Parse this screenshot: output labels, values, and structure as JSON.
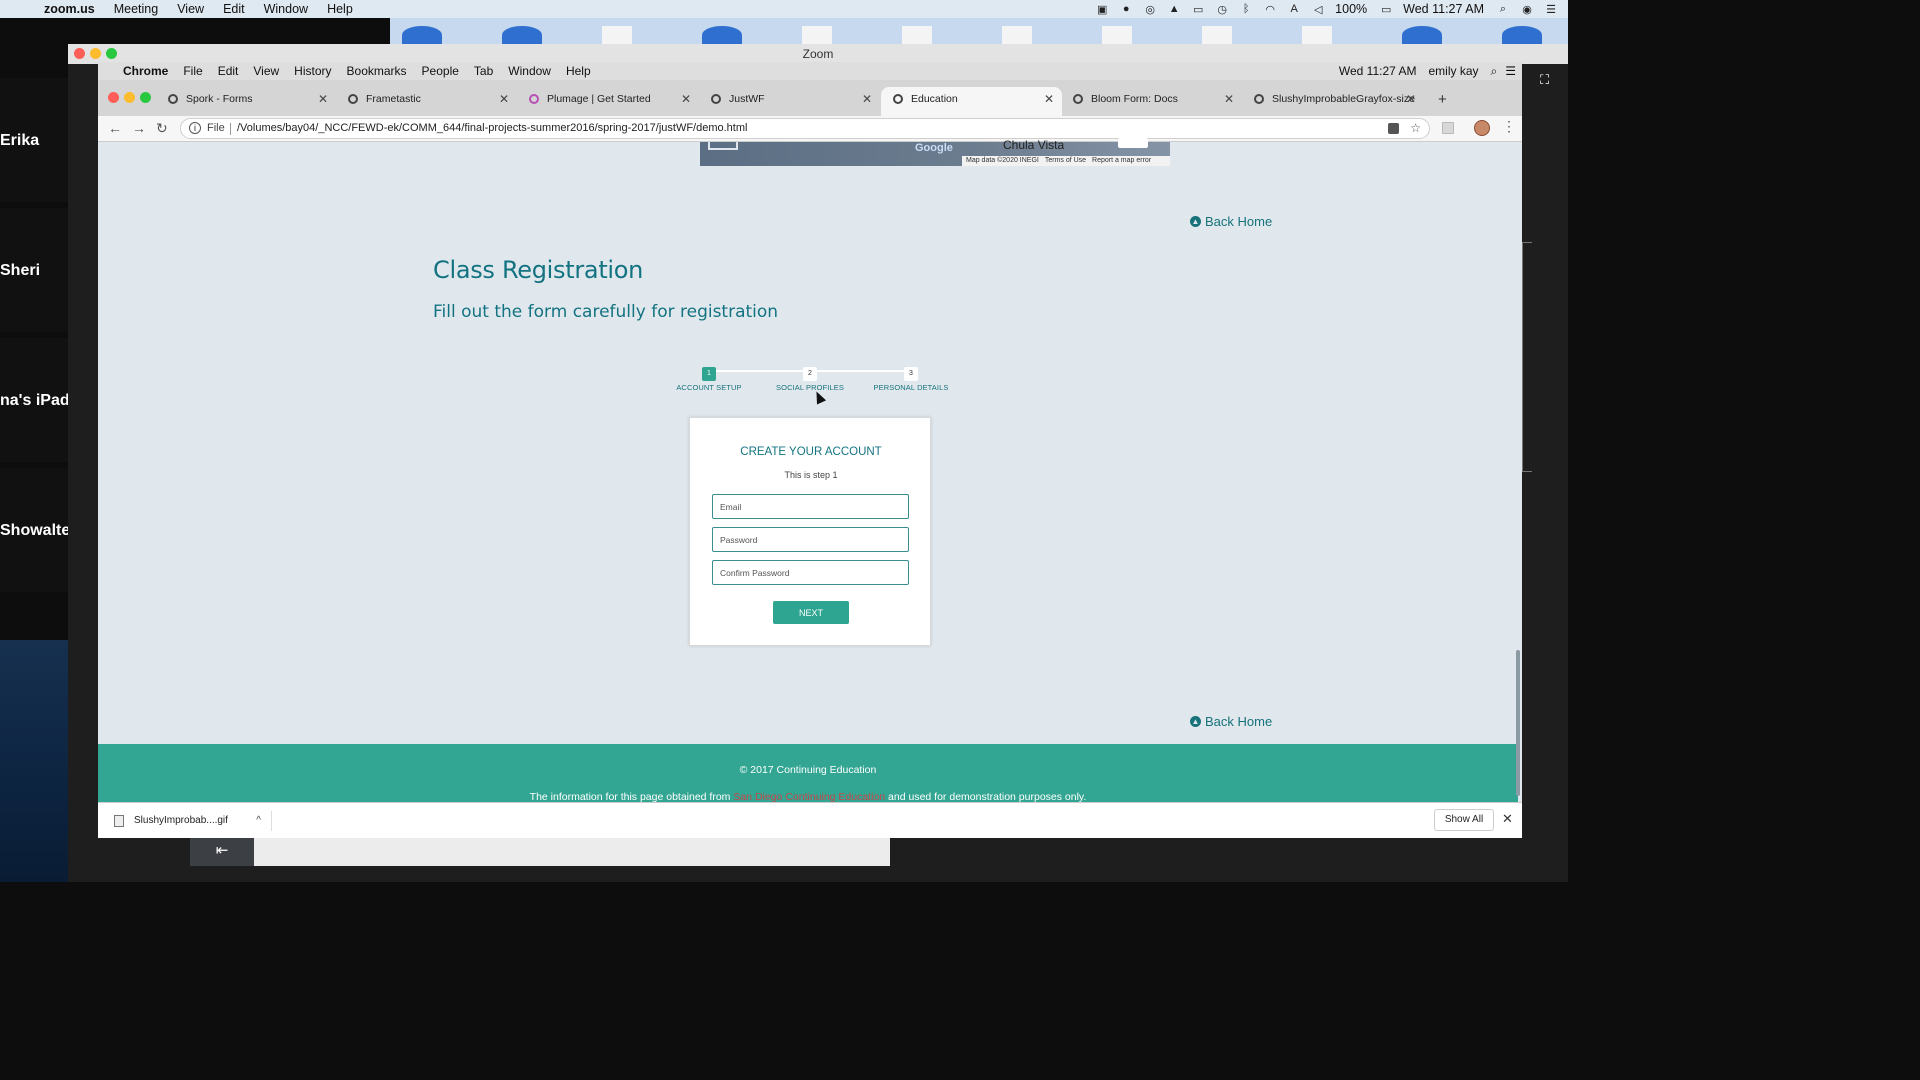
{
  "mac_menubar": {
    "app": "zoom.us",
    "items": [
      "Meeting",
      "View",
      "Edit",
      "Window",
      "Help"
    ],
    "battery": "100%",
    "clock": "Wed 11:27 AM"
  },
  "zoom": {
    "window_title": "Zoom",
    "participants": [
      "Erika",
      "Sheri",
      "na's iPad",
      "Showalte"
    ]
  },
  "chrome": {
    "app_menu": {
      "app": "Chrome",
      "items": [
        "File",
        "Edit",
        "View",
        "History",
        "Bookmarks",
        "People",
        "Tab",
        "Window",
        "Help"
      ],
      "clock": "Wed 11:27 AM",
      "user": "emily kay"
    },
    "tabs": [
      {
        "label": "Spork - Forms"
      },
      {
        "label": "Frametastic"
      },
      {
        "label": "Plumage | Get Started"
      },
      {
        "label": "JustWF"
      },
      {
        "label": "Education"
      },
      {
        "label": "Bloom Form: Docs"
      },
      {
        "label": "SlushyImprobableGrayfox-size"
      }
    ],
    "address": {
      "scheme_label": "File",
      "url": "/Volumes/bay04/_NCC/FEWD-ek/COMM_644/final-projects-summer2016/spring-2017/justWF/demo.html"
    }
  },
  "map": {
    "city": "Chula Vista",
    "google": "Google",
    "attribution": [
      "Map data ©2020 INEGI",
      "Terms of Use",
      "Report a map error"
    ]
  },
  "page": {
    "back_home": "Back Home",
    "title": "Class Registration",
    "subtitle": "Fill out the form carefully for registration",
    "steps": [
      {
        "num": "1",
        "label": "ACCOUNT SETUP"
      },
      {
        "num": "2",
        "label": "SOCIAL PROFILES"
      },
      {
        "num": "3",
        "label": "PERSONAL DETAILS"
      }
    ],
    "form": {
      "title": "CREATE YOUR ACCOUNT",
      "step_text": "This is step 1",
      "email_placeholder": "Email",
      "password_placeholder": "Password",
      "confirm_placeholder": "Confirm Password",
      "next_label": "NEXT"
    },
    "footer": {
      "copyright": "© 2017 Continuing Education",
      "info_prefix": "The information for this page obtained from ",
      "info_link": "San Diego Continuing Education",
      "info_suffix": " and used for demonstration purposes only."
    }
  },
  "downloads": {
    "file": "SlushyImprobab....gif",
    "show_all": "Show All"
  },
  "colors": {
    "accent": "#137381",
    "button": "#2ea590",
    "footer": "#32a692",
    "link": "#c4484c"
  }
}
